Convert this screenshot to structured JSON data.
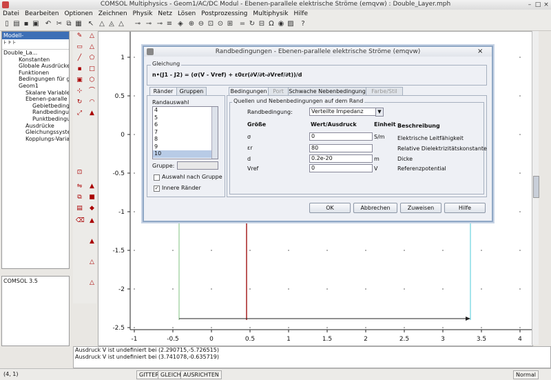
{
  "window": {
    "title": "COMSOL Multiphysics - Geom1/AC/DC Modul - Ebenen-parallele elektrische Ströme (emqvw) : Double_Layer.mph"
  },
  "menu": [
    "Datei",
    "Bearbeiten",
    "Optionen",
    "Zeichnen",
    "Physik",
    "Netz",
    "Lösen",
    "Postprozessing",
    "Multiphysik",
    "Hilfe"
  ],
  "model_tree": {
    "header": "Modell-Verzeichnisbaum",
    "nodes": [
      {
        "label": "Double_La...",
        "indent": 0
      },
      {
        "label": "Konstanten",
        "indent": 1
      },
      {
        "label": "Globale Ausdrücke",
        "indent": 1
      },
      {
        "label": "Funktionen",
        "indent": 1
      },
      {
        "label": "Bedingungen für ge",
        "indent": 1
      },
      {
        "label": "Geom1",
        "indent": 1
      },
      {
        "label": "Skalare Variablen",
        "indent": 2
      },
      {
        "label": "Ebenen-paralle",
        "indent": 2
      },
      {
        "label": "Gebietbeding",
        "indent": 3
      },
      {
        "label": "Randbedingu",
        "indent": 3
      },
      {
        "label": "Punktbedingu",
        "indent": 3
      },
      {
        "label": "Ausdrücke",
        "indent": 2
      },
      {
        "label": "Gleichungssysten",
        "indent": 2
      },
      {
        "label": "Kopplungs-Varia",
        "indent": 2
      }
    ]
  },
  "info_panel": {
    "text": "COMSOL 3.5"
  },
  "plot": {
    "x_ticks": [
      "-1",
      "-0.5",
      "0",
      "0.5",
      "1",
      "1.5",
      "2",
      "2.5",
      "3",
      "3.5",
      "4"
    ],
    "y_ticks": [
      "1",
      "0.5",
      "0",
      "-0.5",
      "-1",
      "-1.5",
      "-2",
      "-2.5"
    ]
  },
  "log": [
    "Ausdruck V ist undefiniert bei (2.290715,-5.726515)",
    "Ausdruck V ist undefiniert bei (3.741078,-0.635719)"
  ],
  "status": {
    "coords": "(4, 1)",
    "gitter": "GITTER",
    "gleich": "GLEICH",
    "ausrichten": "AUSRICHTEN",
    "mode": "Normal"
  },
  "dialog": {
    "title": "Randbedingungen - Ebenen-parallele elektrische Ströme (emqvw)",
    "equation_group": "Gleichung",
    "equation": "n•(J1 - J2) = (σ(V - Vref) + ε0εr(∂V/∂t-∂Vref/∂t))/d",
    "left_tabs": [
      "Ränder",
      "Gruppen"
    ],
    "right_tabs": [
      "Bedingungen",
      "Port",
      "Schwache Nebenbedingung",
      "Farbe/Stil"
    ],
    "randauswahl_label": "Randauswahl",
    "boundary_list": [
      "4",
      "5",
      "6",
      "7",
      "8",
      "9",
      "10"
    ],
    "selected_boundary": "10",
    "gruppe_label": "Gruppe:",
    "auswahl_nach_gruppe": "Auswahl nach Gruppe",
    "innere_raender": "Innere Ränder",
    "quellen_group": "Quellen und Nebenbedingungen auf dem Rand",
    "randbedingung_label": "Randbedingung:",
    "randbedingung_value": "Verteilte Impedanz",
    "table_headers": {
      "groesse": "Größe",
      "wert": "Wert/Ausdruck",
      "einheit": "Einheit",
      "beschreibung": "Beschreibung"
    },
    "rows": [
      {
        "name": "σ",
        "value": "0",
        "unit": "S/m",
        "desc": "Elektrische Leitfähigkeit"
      },
      {
        "name": "εr",
        "value": "80",
        "unit": "",
        "desc": "Relative Dielektrizitätskonstante"
      },
      {
        "name": "d",
        "value": "0.2e-20",
        "unit": "m",
        "desc": "Dicke"
      },
      {
        "name": "Vref",
        "value": "0",
        "unit": "V",
        "desc": "Referenzpotential"
      }
    ],
    "buttons": {
      "ok": "OK",
      "cancel": "Abbrechen",
      "apply": "Zuweisen",
      "help": "Hilfe"
    }
  }
}
